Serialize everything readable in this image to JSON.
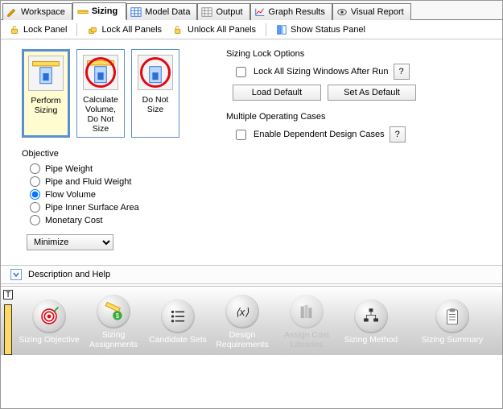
{
  "tabs": [
    {
      "label": "Workspace",
      "icon": "pencil-icon"
    },
    {
      "label": "Sizing",
      "icon": "ruler-icon",
      "active": true
    },
    {
      "label": "Model Data",
      "icon": "table-icon"
    },
    {
      "label": "Output",
      "icon": "grid-icon"
    },
    {
      "label": "Graph Results",
      "icon": "chart-icon"
    },
    {
      "label": "Visual Report",
      "icon": "eye-icon"
    }
  ],
  "subtoolbar": {
    "lock_panel": "Lock Panel",
    "lock_all": "Lock All Panels",
    "unlock_all": "Unlock All Panels",
    "show_status": "Show Status Panel"
  },
  "tiles": {
    "perform": "Perform Sizing",
    "calc_no_size": "Calculate Volume, Do Not Size",
    "do_not_size": "Do Not Size"
  },
  "objective": {
    "title": "Objective",
    "options": {
      "pipe_weight": "Pipe Weight",
      "pipe_fluid_weight": "Pipe and Fluid Weight",
      "flow_volume": "Flow Volume",
      "pipe_inner_surface": "Pipe Inner Surface Area",
      "monetary_cost": "Monetary Cost"
    },
    "selected": "flow_volume",
    "mode_selected": "Minimize"
  },
  "sizing_lock": {
    "title": "Sizing Lock Options",
    "checkbox": "Lock All Sizing Windows After Run",
    "help": "?",
    "load_default": "Load Default",
    "set_default": "Set As Default"
  },
  "multi_cases": {
    "title": "Multiple Operating Cases",
    "checkbox": "Enable Dependent Design Cases",
    "help": "?"
  },
  "description_bar": "Description and Help",
  "ribbon": {
    "items": [
      {
        "label": "Sizing Objective",
        "icon": "target-icon"
      },
      {
        "label": "Sizing Assignments",
        "icon": "ruler-money-icon"
      },
      {
        "label": "Candidate Sets",
        "icon": "list-icon"
      },
      {
        "label": "Design Requirements",
        "icon": "variable-icon"
      },
      {
        "label": "Assign Cost Libraries",
        "icon": "books-icon",
        "disabled": true
      },
      {
        "label": "Sizing Method",
        "icon": "flow-icon"
      }
    ],
    "summary": {
      "label": "Sizing Summary",
      "icon": "clipboard-icon"
    }
  }
}
